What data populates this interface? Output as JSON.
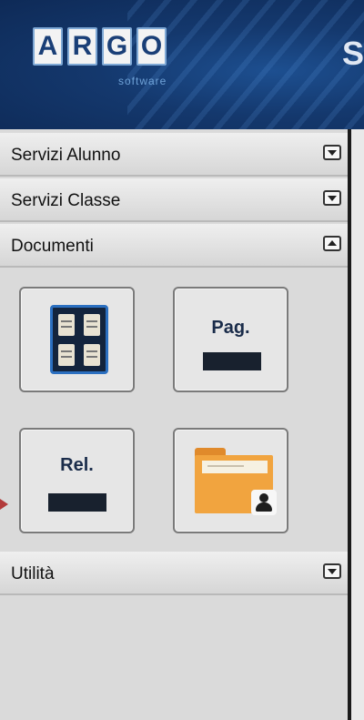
{
  "header": {
    "logo_letters": [
      "A",
      "R",
      "G",
      "O"
    ],
    "logo_subtitle": "software",
    "title_partial": "S"
  },
  "sidebar": {
    "sections": [
      {
        "label": "Servizi Alunno",
        "state": "collapsed"
      },
      {
        "label": "Servizi Classe",
        "state": "collapsed"
      },
      {
        "label": "Documenti",
        "state": "expanded"
      },
      {
        "label": "Utilità",
        "state": "collapsed"
      }
    ],
    "documenti_tiles": [
      {
        "icon": "document-grid-icon",
        "text": ""
      },
      {
        "icon": "page-icon",
        "text": "Pag."
      },
      {
        "icon": "report-icon",
        "text": "Rel."
      },
      {
        "icon": "student-folder-icon",
        "text": ""
      }
    ]
  },
  "colors": {
    "header_bg": "#14386d",
    "logo_text": "#1a3f77",
    "folder": "#f1a43f"
  }
}
